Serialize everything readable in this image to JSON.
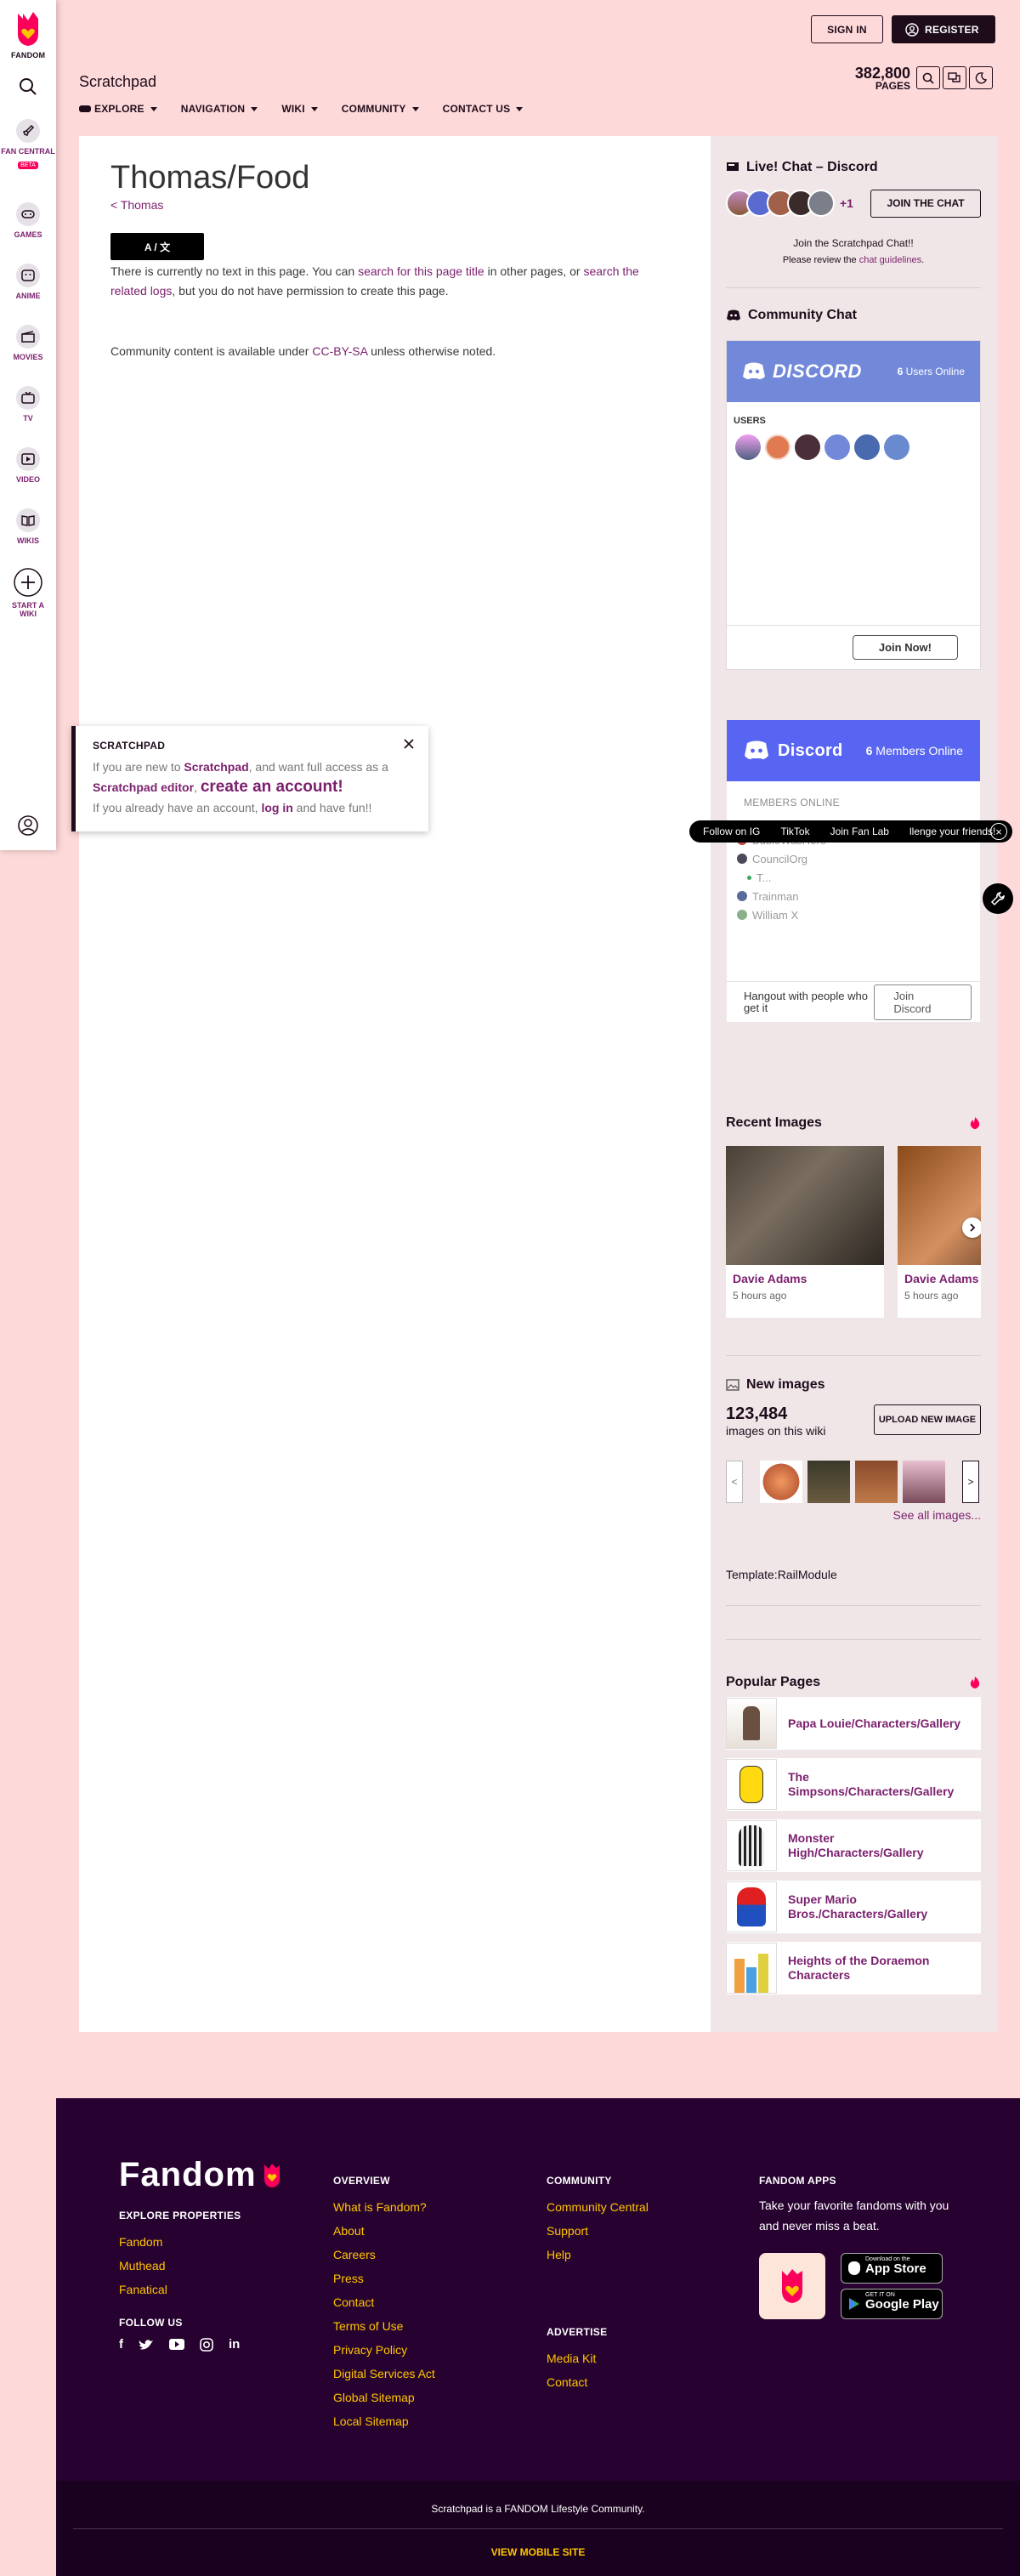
{
  "global_nav": {
    "logo_label": "FANDOM",
    "items": [
      {
        "label": "FAN CENTRAL",
        "badge": "BETA",
        "icon": "rocket-icon"
      },
      {
        "label": "GAMES",
        "icon": "gamepad-icon"
      },
      {
        "label": "ANIME",
        "icon": "anime-icon"
      },
      {
        "label": "MOVIES",
        "icon": "clapper-icon"
      },
      {
        "label": "TV",
        "icon": "tv-icon"
      },
      {
        "label": "VIDEO",
        "icon": "play-icon"
      },
      {
        "label": "WIKIS",
        "icon": "book-icon"
      },
      {
        "label": "START A WIKI",
        "icon": "plus-icon"
      }
    ]
  },
  "auth": {
    "sign_in": "SIGN IN",
    "register": "REGISTER"
  },
  "header": {
    "wiki_name": "Scratchpad",
    "pages_count": "382,800",
    "pages_label": "PAGES",
    "nav": [
      "EXPLORE",
      "NAVIGATION",
      "WIKI",
      "COMMUNITY",
      "CONTACT US"
    ]
  },
  "article": {
    "title": "Thomas/Food",
    "back_link": "< Thomas",
    "lang_button": "A / 文",
    "notext": {
      "t1": "There is currently no text in this page. You can ",
      "l1": "search for this page title",
      "t2": " in other pages, or ",
      "l2": "search the related logs",
      "t3": ", but you do not have permission to create this page."
    },
    "license": {
      "t1": "Community content is available under ",
      "link": "CC-BY-SA",
      "t2": " unless otherwise noted."
    }
  },
  "rail": {
    "live_chat": {
      "title": "Live! Chat – Discord",
      "more": "+1",
      "join_button": "JOIN THE CHAT",
      "line1": "Join the Scratchpad Chat!!",
      "line2_pre": "Please review the ",
      "line2_link": "chat guidelines",
      "line2_post": "."
    },
    "community_chat": {
      "title": "Community Chat",
      "discord_word": "DISCORD",
      "online_n": "6",
      "online_label": " Users Online",
      "users_label": "USERS",
      "join_now": "Join Now!"
    },
    "discord_widget": {
      "name": "Discord",
      "online_n": "6",
      "online_label": " Members Online",
      "members_label": "MEMBERS ONLINE",
      "members": [
        "BubleWasHere",
        "CouncilOrg",
        "T...",
        "Trainman",
        "William X"
      ],
      "footer_text": "Hangout with people who get it",
      "join_button": "Join Discord"
    },
    "recent_images": {
      "title": "Recent Images",
      "items": [
        {
          "name": "Davie Adams",
          "time": "5 hours ago"
        },
        {
          "name": "Davie Adams",
          "time": "5 hours ago"
        }
      ]
    },
    "new_images": {
      "title": "New images",
      "count": "123,484",
      "count_label": "images on this wiki",
      "upload_button": "UPLOAD NEW IMAGE",
      "prev": "<",
      "next": ">",
      "see_all": "See all images..."
    },
    "template_module": "Template:RailModule",
    "popular_pages": {
      "title": "Popular Pages",
      "items": [
        "Papa Louie/Characters/Gallery",
        "The Simpsons/Characters/Gallery",
        "Monster High/Characters/Gallery",
        "Super Mario Bros./Characters/Gallery",
        "Heights of the Doraemon Characters"
      ]
    }
  },
  "popup": {
    "title": "SCRATCHPAD",
    "l1_pre": "If you are new to ",
    "l1_link": "Scratchpad",
    "l1_post": ", and want full access as a",
    "l2_link": "Scratchpad editor",
    "l2_mid": ", ",
    "l2_big": "create an account!",
    "l3_pre": "If you already have an account, ",
    "l3_link": "log in",
    "l3_post": " and have fun!!"
  },
  "fan_bar": {
    "items": [
      "Follow on IG",
      "TikTok",
      "Join Fan Lab",
      "llenge your friends!"
    ]
  },
  "footer": {
    "logo": "Fandom",
    "explore_title": "EXPLORE PROPERTIES",
    "explore": [
      "Fandom",
      "Muthead",
      "Fanatical"
    ],
    "follow_title": "FOLLOW US",
    "overview_title": "OVERVIEW",
    "overview": [
      "What is Fandom?",
      "About",
      "Careers",
      "Press",
      "Contact",
      "Terms of Use",
      "Privacy Policy",
      "Digital Services Act",
      "Global Sitemap",
      "Local Sitemap"
    ],
    "community_title": "COMMUNITY",
    "community": [
      "Community Central",
      "Support",
      "Help"
    ],
    "advertise_title": "ADVERTISE",
    "advertise": [
      "Media Kit",
      "Contact"
    ],
    "apps_title": "FANDOM APPS",
    "apps_text": "Take your favorite fandoms with you and never miss a beat.",
    "app_store_small": "Download on the",
    "app_store": "App Store",
    "google_small": "GET IT ON",
    "google": "Google Play",
    "lifestyle": "Scratchpad is a FANDOM Lifestyle Community.",
    "mobile": "VIEW MOBILE SITE"
  },
  "colors": {
    "accent": "#7b1f6d",
    "page_bg": "#fed9d9",
    "footer_bg": "#270230",
    "link_yellow": "#ffc500",
    "discord": "#5865f2"
  }
}
